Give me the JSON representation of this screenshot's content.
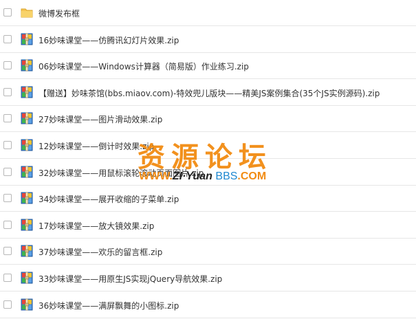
{
  "file_list": {
    "items": [
      {
        "icon": "folder-icon",
        "name": "微博发布框"
      },
      {
        "icon": "zip-archive-icon",
        "name": "16妙味课堂——仿腾讯幻灯片效果.zip"
      },
      {
        "icon": "zip-archive-icon",
        "name": "06妙味课堂——Windows计算器（简易版）作业练习.zip"
      },
      {
        "icon": "zip-archive-icon",
        "name": "【赠送】妙味茶馆(bbs.miaov.com)-特效兜儿版块——精美JS案例集合(35个JS实例源码).zip"
      },
      {
        "icon": "zip-archive-icon",
        "name": "27妙味课堂——图片滑动效果.zip"
      },
      {
        "icon": "zip-archive-icon",
        "name": "12妙味课堂——倒计时效果.zip"
      },
      {
        "icon": "zip-archive-icon",
        "name": "32妙味课堂——用鼠标滚轮滚动页面图片.zip"
      },
      {
        "icon": "zip-archive-icon",
        "name": "34妙味课堂——展开收缩的子菜单.zip"
      },
      {
        "icon": "zip-archive-icon",
        "name": "17妙味课堂——放大镜效果.zip"
      },
      {
        "icon": "zip-archive-icon",
        "name": "37妙味课堂——欢乐的留言框.zip"
      },
      {
        "icon": "zip-archive-icon",
        "name": "33妙味课堂——用原生JS实现jQuery导航效果.zip"
      },
      {
        "icon": "zip-archive-icon",
        "name": "36妙味课堂——满屏飘舞的小图标.zip"
      }
    ]
  },
  "watermark": {
    "title": "资源论坛",
    "www": "WWW.",
    "zi": "ZI",
    "yuan": "·Yuan",
    "bbs": "BBS",
    "com": ".COM"
  },
  "colors": {
    "text": "#333333",
    "divider": "#e6e6e6",
    "folder": "#f5c451",
    "watermark_orange": "#f28c13",
    "watermark_blue": "#1e88d0"
  }
}
